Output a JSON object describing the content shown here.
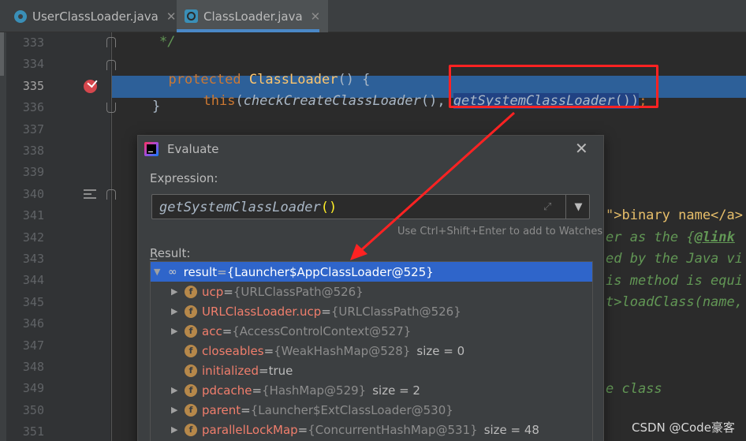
{
  "tabs": [
    {
      "label": "UserClassLoader.java",
      "close": "✕",
      "active": false
    },
    {
      "label": "ClassLoader.java",
      "close": "✕",
      "active": true
    }
  ],
  "gutter": {
    "lines": [
      "333",
      "334",
      "335",
      "336",
      "337",
      "338",
      "339",
      "340",
      "341",
      "342",
      "343",
      "344",
      "345",
      "346",
      "347",
      "348",
      "349",
      "350",
      "351"
    ],
    "current_line": "335"
  },
  "code": {
    "l333": "*/",
    "l334_kw": "protected",
    "l334_cls": "ClassLoader",
    "l334_rest": "() {",
    "l335_this": "this",
    "l335_call1": "checkCreateClassLoader",
    "l335_mid": "(), ",
    "l335_call2": "getSystemClassLoader",
    "l335_end": "())",
    "l335_semi": ";",
    "l336": "}",
    "frag341_a": "\">binary name</a>",
    "frag342_a": "er as the {",
    "frag342_tag": "@link",
    "frag343": "ed by the Java vi",
    "frag344": "is method is equi",
    "frag345": "t>loadClass(name,",
    "frag349": "e class"
  },
  "dialog": {
    "title": "Evaluate",
    "close": "✕",
    "expression_label": "Expression:",
    "expression_text": "getSystemClassLoader",
    "expression_parens": "()",
    "dropdown_arrow": "▼",
    "expand_glyph": "⤢",
    "hint": "Use Ctrl+Shift+Enter to add to Watches",
    "result_label": "Result:",
    "result": {
      "name": "result",
      "eq": " = ",
      "value": "{Launcher$AppClassLoader@525}",
      "icon": "glasses-icon",
      "glasses": "∞",
      "arrow_open": "▼"
    },
    "field_icon_letter": "f",
    "arrow_closed": "▶",
    "fields": [
      {
        "name": "ucp",
        "value": "{URLClassPath@526}",
        "extra": "",
        "expandable": true
      },
      {
        "name": "URLClassLoader.ucp",
        "value": "{URLClassPath@526}",
        "extra": "",
        "expandable": true
      },
      {
        "name": "acc",
        "value": "{AccessControlContext@527}",
        "extra": "",
        "expandable": true
      },
      {
        "name": "closeables",
        "value": "{WeakHashMap@528}",
        "extra": "size = 0",
        "expandable": false
      },
      {
        "name": "initialized",
        "value": "true",
        "extra": "",
        "expandable": false
      },
      {
        "name": "pdcache",
        "value": "{HashMap@529}",
        "extra": "size = 2",
        "expandable": true
      },
      {
        "name": "parent",
        "value": "{Launcher$ExtClassLoader@530}",
        "extra": "",
        "expandable": true
      },
      {
        "name": "parallelLockMap",
        "value": "{ConcurrentHashMap@531}",
        "extra": "size = 48",
        "expandable": true
      }
    ]
  },
  "annotation_color": "#ff2222",
  "selection_color": "#2f65ca",
  "watermark": "CSDN @Code豪客"
}
